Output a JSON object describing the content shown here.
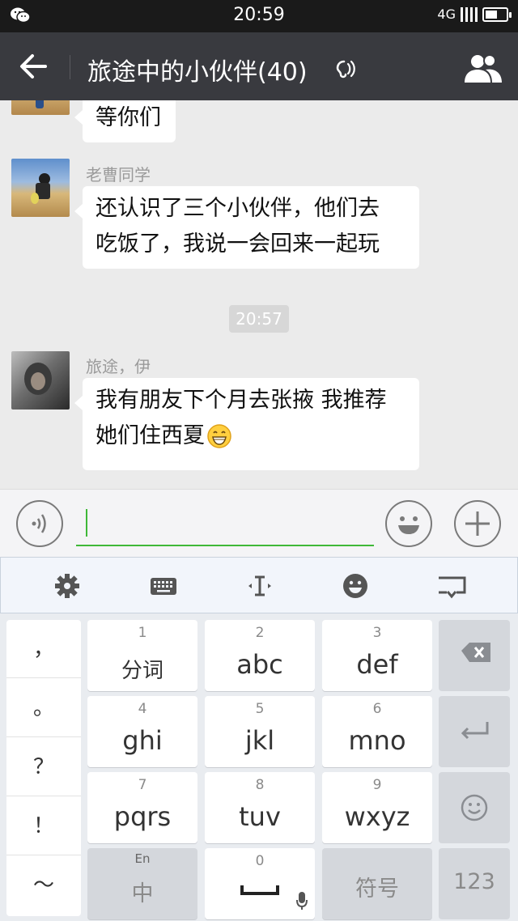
{
  "status_bar": {
    "time": "20:59",
    "network": "4G"
  },
  "header": {
    "title": "旅途中的小伙伴(40)"
  },
  "messages": [
    {
      "sender": "",
      "text": "等你们"
    },
    {
      "sender": "老曹同学",
      "text_line1": "还认识了三个小伙伴，他们去",
      "text_line2": "吃饭了，我说一会回来一起玩"
    },
    {
      "sender": "旅途，伊",
      "text_line1": "我有朋友下个月去张掖 我推荐",
      "text_line2": "她们住西夏"
    }
  ],
  "timestamp": "20:57",
  "input": {
    "value": ""
  },
  "keyboard": {
    "punctuation": [
      "，",
      "。",
      "？",
      "！",
      "～"
    ],
    "keys": [
      {
        "num": "1",
        "letters": "分词"
      },
      {
        "num": "2",
        "letters": "abc"
      },
      {
        "num": "3",
        "letters": "def"
      },
      {
        "num": "4",
        "letters": "ghi"
      },
      {
        "num": "5",
        "letters": "jkl"
      },
      {
        "num": "6",
        "letters": "mno"
      },
      {
        "num": "7",
        "letters": "pqrs"
      },
      {
        "num": "8",
        "letters": "tuv"
      },
      {
        "num": "9",
        "letters": "wxyz"
      }
    ],
    "lang_key": {
      "top": "En",
      "main": "中"
    },
    "space_key": {
      "num": "0"
    },
    "symbol_key": "符号",
    "number_key": "123"
  },
  "colors": {
    "accent": "#3fb838",
    "header_bg": "#393a3f",
    "status_bg": "#1a1a1a",
    "chat_bg": "#ebebeb"
  },
  "icons": [
    "wechat-icon",
    "signal-icon",
    "battery-icon",
    "back-arrow-icon",
    "earpiece-icon",
    "group-members-icon",
    "voice-icon",
    "emoji-icon",
    "plus-icon",
    "settings-icon",
    "keyboard-icon",
    "cursor-icon",
    "emoji-icon",
    "keyboard-hide-icon",
    "backspace-icon",
    "enter-icon",
    "smiley-icon",
    "mic-icon"
  ]
}
